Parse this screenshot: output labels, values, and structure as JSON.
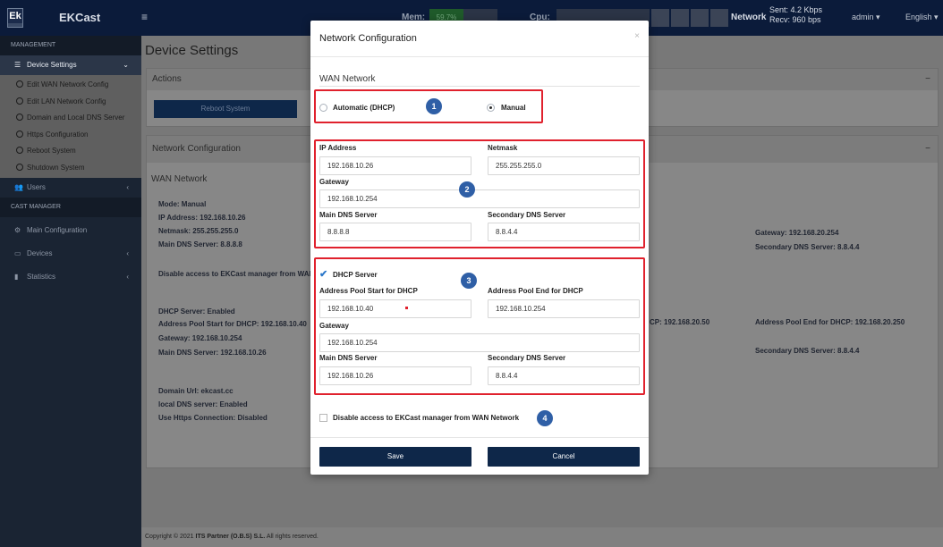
{
  "app": {
    "logo_text": "Ek",
    "brand": "EKCast",
    "menu_glyph": "≡"
  },
  "topbar": {
    "mem_label": "Mem:",
    "mem_value": "59.7%",
    "cpu_label": "Cpu:",
    "network_label": "Network",
    "sent": "Sent: 4.2 Kbps",
    "recv": "Recv: 960 bps",
    "user": "admin ▾",
    "language": "English ▾"
  },
  "sidebar": {
    "management": "MANAGEMENT",
    "device_settings": "Device Settings",
    "items": [
      "Edit WAN Network Config",
      "Edit LAN Network Config",
      "Domain and Local DNS Server",
      "Https Configuration",
      "Reboot System",
      "Shutdown System"
    ],
    "users": "Users",
    "cast_manager": "CAST MANAGER",
    "main_configuration": "Main Configuration",
    "devices": "Devices",
    "statistics": "Statistics"
  },
  "page": {
    "title": "Device Settings",
    "actions": "Actions",
    "reboot": "Reboot System",
    "netconf": "Network Configuration",
    "wan": "WAN Network",
    "bg": {
      "mode": "Mode: Manual",
      "ip": "IP Address: 192.168.10.26",
      "netmask": "Netmask: 255.255.255.0",
      "main_dns": "Main DNS Server: 8.8.8.8",
      "disable": "Disable access to EKCast manager from WAN",
      "gw2": "Gateway: 192.168.20.254",
      "sdns2": "Secondary DNS Server: 8.8.4.4",
      "dhcp_server": "DHCP Server: Enabled",
      "pool_start": "Address Pool Start for DHCP: 192.168.10.40",
      "gw": "Gateway: 192.168.10.254",
      "main_dns2": "Main DNS Server: 192.168.10.26",
      "pool_start2": "CP: 192.168.20.50",
      "pool_end2": "Address Pool End for DHCP: 192.168.20.250",
      "sdns3": "Secondary DNS Server: 8.8.4.4",
      "domain": "Domain Url: ekcast.cc",
      "local_dns": "local DNS server: Enabled",
      "https": "Use Https Connection: Disabled"
    },
    "footer_prefix": "Copyright © 2021 ",
    "footer_company": "ITS Partner (O.B.S) S.L.",
    "footer_suffix": " All rights reserved."
  },
  "modal": {
    "title": "Network Configuration",
    "close": "×",
    "section": "WAN Network",
    "auto_label": "Automatic (DHCP)",
    "manual_label": "Manual",
    "ip_label": "IP Address",
    "ip_value": "192.168.10.26",
    "netmask_label": "Netmask",
    "netmask_value": "255.255.255.0",
    "gateway_label": "Gateway",
    "gateway_value": "192.168.10.254",
    "main_dns_label": "Main DNS Server",
    "main_dns_value": "8.8.8.8",
    "sec_dns_label": "Secondary DNS Server",
    "sec_dns_value": "8.8.4.4",
    "dhcp_label": "DHCP Server",
    "pool_start_label": "Address Pool Start for DHCP",
    "pool_start_value": "192.168.10.40",
    "pool_end_label": "Address Pool End for DHCP",
    "pool_end_value": "192.168.10.254",
    "dhcp_gateway_label": "Gateway",
    "dhcp_gateway_value": "192.168.10.254",
    "dhcp_main_dns_label": "Main DNS Server",
    "dhcp_main_dns_value": "192.168.10.26",
    "dhcp_sec_dns_label": "Secondary DNS Server",
    "dhcp_sec_dns_value": "8.8.4.4",
    "disable_wan_label": "Disable access to EKCast manager from WAN Network",
    "save": "Save",
    "cancel": "Cancel",
    "badges": [
      "1",
      "2",
      "3",
      "4"
    ]
  },
  "colors": {
    "accent": "#2f5fa6",
    "highlight": "#e0212d",
    "button": "#0e2749"
  }
}
